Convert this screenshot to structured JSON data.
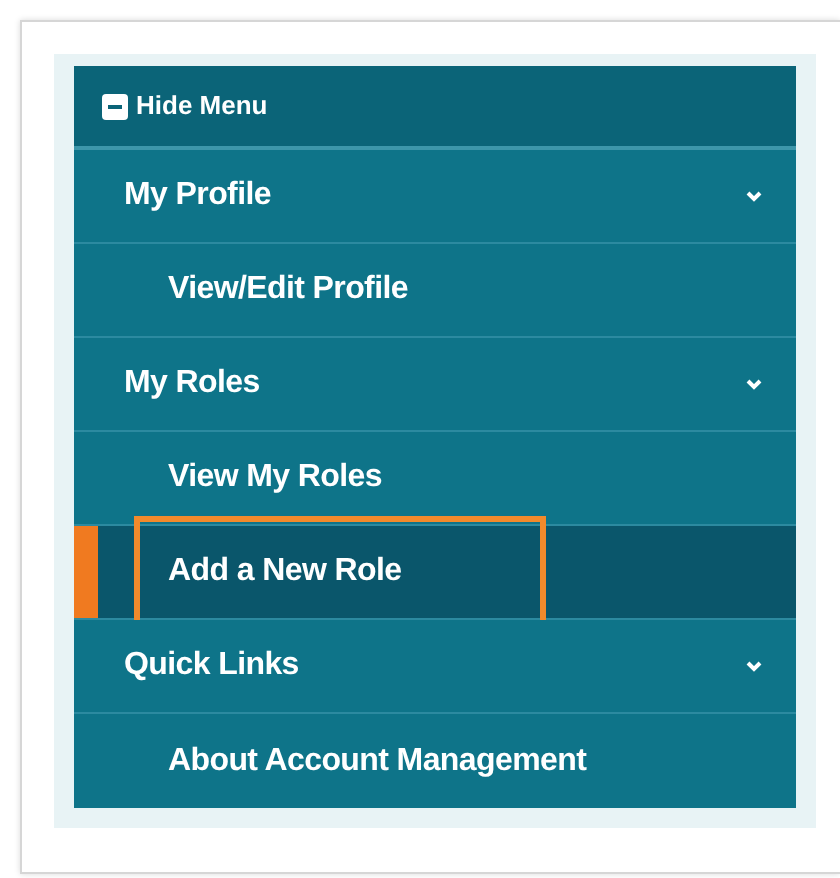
{
  "menu": {
    "toggle": {
      "label": "Hide Menu"
    },
    "sections": [
      {
        "label": "My Profile",
        "expanded": true,
        "children": [
          {
            "label": "View/Edit Profile",
            "selected": false,
            "annotated": false
          }
        ]
      },
      {
        "label": "My Roles",
        "expanded": true,
        "children": [
          {
            "label": "View My Roles",
            "selected": false,
            "annotated": false
          },
          {
            "label": "Add a New Role",
            "selected": true,
            "annotated": true
          }
        ]
      },
      {
        "label": "Quick Links",
        "expanded": true,
        "children": [
          {
            "label": "About Account Management",
            "selected": false,
            "annotated": false
          }
        ]
      }
    ]
  }
}
